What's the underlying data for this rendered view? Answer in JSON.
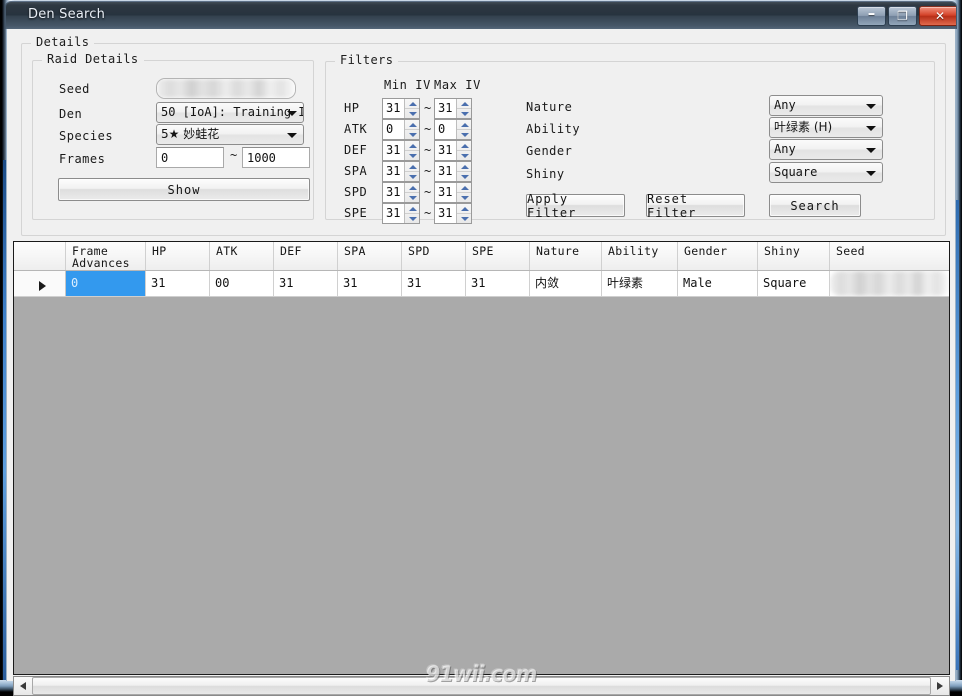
{
  "window": {
    "title": "Den Search",
    "controls": {
      "minimize": "–",
      "maximize": "❐",
      "close": "✕"
    }
  },
  "details": {
    "group_title": "Details",
    "raid": {
      "group_title": "Raid Details",
      "seed_label": "Seed",
      "seed_value": "",
      "den_label": "Den",
      "den_value": "50 [IoA]: Training I",
      "species_label": "Species",
      "species_value": "5★ 妙蛙花",
      "frames_label": "Frames",
      "frames_min": "0",
      "frames_separator": "~",
      "frames_max": "1000",
      "show_button": "Show"
    },
    "filters": {
      "group_title": "Filters",
      "min_iv_header": "Min IV",
      "max_iv_header": "Max IV",
      "separator": "~",
      "stats": [
        {
          "label": "HP",
          "min": "31",
          "max": "31"
        },
        {
          "label": "ATK",
          "min": "0",
          "max": "0"
        },
        {
          "label": "DEF",
          "min": "31",
          "max": "31"
        },
        {
          "label": "SPA",
          "min": "31",
          "max": "31"
        },
        {
          "label": "SPD",
          "min": "31",
          "max": "31"
        },
        {
          "label": "SPE",
          "min": "31",
          "max": "31"
        }
      ],
      "nature_label": "Nature",
      "nature_value": "Any",
      "ability_label": "Ability",
      "ability_value": "叶绿素 (H)",
      "gender_label": "Gender",
      "gender_value": "Any",
      "shiny_label": "Shiny",
      "shiny_value": "Square",
      "apply_button": "Apply Filter",
      "reset_button": "Reset Filter",
      "search_button": "Search"
    }
  },
  "grid": {
    "columns": [
      {
        "key": "rowsel",
        "label": "",
        "width": 52
      },
      {
        "key": "frame",
        "label": "Frame\nAdvances",
        "width": 80
      },
      {
        "key": "hp",
        "label": "HP",
        "width": 64
      },
      {
        "key": "atk",
        "label": "ATK",
        "width": 64
      },
      {
        "key": "def",
        "label": "DEF",
        "width": 64
      },
      {
        "key": "spa",
        "label": "SPA",
        "width": 64
      },
      {
        "key": "spd",
        "label": "SPD",
        "width": 64
      },
      {
        "key": "spe",
        "label": "SPE",
        "width": 64
      },
      {
        "key": "nature",
        "label": "Nature",
        "width": 72
      },
      {
        "key": "ability",
        "label": "Ability",
        "width": 76
      },
      {
        "key": "gender",
        "label": "Gender",
        "width": 80
      },
      {
        "key": "shiny",
        "label": "Shiny",
        "width": 72
      },
      {
        "key": "seed",
        "label": "Seed",
        "width": 120
      }
    ],
    "rows": [
      {
        "selector": "▶",
        "frame": "0",
        "hp": "31",
        "atk": "00",
        "def": "31",
        "spa": "31",
        "spd": "31",
        "spe": "31",
        "nature": "内敛",
        "ability": "叶绿素",
        "gender": "Male",
        "shiny": "Square",
        "seed": ""
      }
    ]
  },
  "scrollbar": {
    "left_arrow": "◀",
    "right_arrow": "▶"
  },
  "watermark": "91wii.com",
  "colors": {
    "selection": "#3399ee",
    "grid_empty": "#aaaaaa",
    "window_face": "#f0f0f0",
    "close_button": "#d4432a"
  }
}
